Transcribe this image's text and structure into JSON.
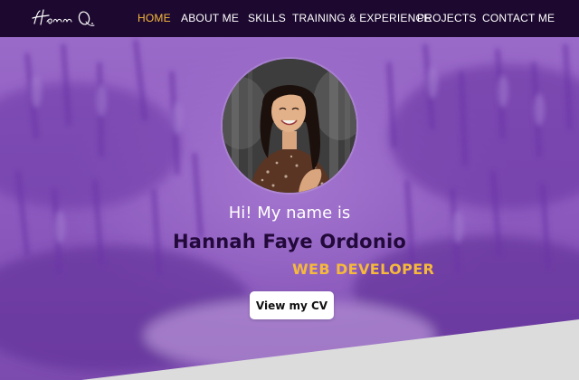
{
  "nav": {
    "logo_text": "Hann O.",
    "items": [
      {
        "label": "HOME",
        "active": true
      },
      {
        "label": "ABOUT ME",
        "active": false
      },
      {
        "label": "SKILLS",
        "active": false
      },
      {
        "label": "TRAINING & EXPERIENCE",
        "active": false
      },
      {
        "label": "PROJECTS",
        "active": false
      },
      {
        "label": "CONTACT ME",
        "active": false
      }
    ]
  },
  "hero": {
    "greeting": "Hi! My name is",
    "name": "Hannah Faye Ordonio",
    "role": "WEB DEVELOPER",
    "cv_button": "View my CV"
  },
  "colors": {
    "nav_bg": "#1d0930",
    "accent": "#f6b93b",
    "name_color": "#22093a",
    "hero_purple": "#8c58bf"
  }
}
